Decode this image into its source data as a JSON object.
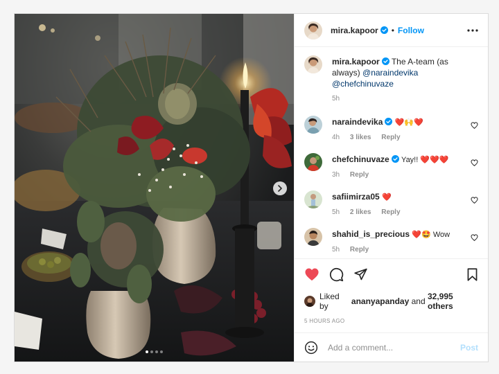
{
  "colors": {
    "link": "#0095f6",
    "like_red": "#ed4956",
    "verified": "#0095f6",
    "post_disabled": "#b2dffc",
    "muted": "#8e8e8e"
  },
  "photo": {
    "description_icon": "image-carousel",
    "slide_count": 4,
    "active_slide": 1
  },
  "header": {
    "username": "mira.kapoor",
    "separator": "•",
    "follow_label": "Follow",
    "more_icon": "more-horizontal-icon"
  },
  "caption": {
    "username": "mira.kapoor",
    "text": "The A-team (as always)",
    "mentions": "@naraindevika @chefchinuvaze",
    "time": "5h"
  },
  "comments": [
    {
      "username": "naraindevika",
      "verified": true,
      "text": "❤️🙌❤️",
      "time": "4h",
      "likes": "3 likes",
      "reply": "Reply"
    },
    {
      "username": "chefchinuvaze",
      "verified": true,
      "text": "Yay!! ❤️❤️❤️",
      "time": "3h",
      "likes": "",
      "reply": "Reply"
    },
    {
      "username": "safiimirza05",
      "verified": false,
      "text": "❤️",
      "time": "5h",
      "likes": "2 likes",
      "reply": "Reply"
    },
    {
      "username": "shahid_is_precious",
      "verified": false,
      "text": "❤️🤩 Wow",
      "time": "5h",
      "likes": "",
      "reply": "Reply"
    }
  ],
  "actions": {
    "like_icon": "heart-filled-icon",
    "comment_icon": "comment-icon",
    "share_icon": "share-icon",
    "save_icon": "bookmark-icon"
  },
  "likes": {
    "prefix": "Liked by",
    "user": "ananyapanday",
    "middle": "and",
    "count": "32,995 others"
  },
  "timestamp": "5 HOURS AGO",
  "add_comment": {
    "placeholder": "Add a comment...",
    "post_label": "Post"
  }
}
